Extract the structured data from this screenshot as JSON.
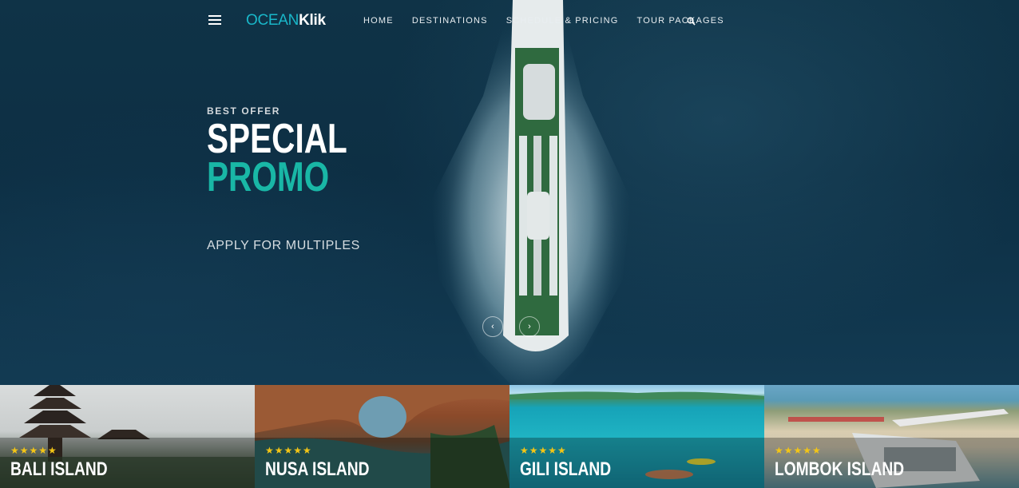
{
  "brand": {
    "logo_part1": "OCEAN",
    "logo_part2": "Klik"
  },
  "nav": {
    "items": [
      "HOME",
      "DESTINATIONS",
      "SCHEDULE & PRICING",
      "TOUR PACKAGES"
    ],
    "search_icon": "search-icon",
    "menu_icon": "hamburger-menu-icon"
  },
  "hero": {
    "eyebrow": "BEST OFFER",
    "title_line1": "SPECIAL",
    "title_line2": "PROMO",
    "subtitle": "APPLY FOR MULTIPLES",
    "prev_icon": "chevron-left-icon",
    "next_icon": "chevron-right-icon"
  },
  "cards": [
    {
      "name": "BALI ISLAND",
      "stars": "★★★★★"
    },
    {
      "name": "NUSA ISLAND",
      "stars": "★★★★★"
    },
    {
      "name": "GILI ISLAND",
      "stars": "★★★★★"
    },
    {
      "name": "LOMBOK ISLAND",
      "stars": "★★★★★"
    }
  ],
  "colors": {
    "accent": "#19b7a6",
    "logo_accent": "#19b7c9",
    "star": "#f3c516"
  }
}
